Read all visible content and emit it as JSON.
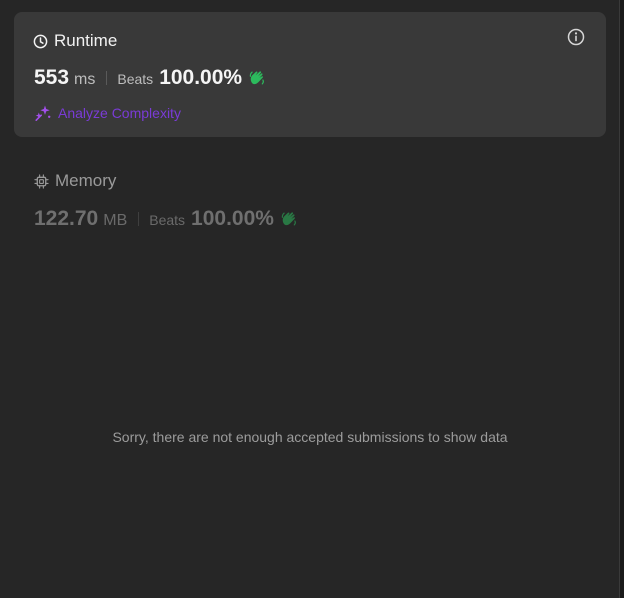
{
  "runtime": {
    "title": "Runtime",
    "value": "553",
    "unit": "ms",
    "beats_label": "Beats",
    "beats_value": "100.00%",
    "analyze_label": "Analyze Complexity"
  },
  "memory": {
    "title": "Memory",
    "value": "122.70",
    "unit": "MB",
    "beats_label": "Beats",
    "beats_value": "100.00%"
  },
  "empty_message": "Sorry, there are not enough accepted submissions to show data",
  "icons": {
    "runtime": "clock-icon",
    "info": "info-icon",
    "beats": "clapping-hands-icon",
    "analyze": "sparkle-icon",
    "memory": "cpu-chip-icon"
  },
  "colors": {
    "background": "#262626",
    "card": "#393939",
    "beats_icon": "#2cbb5d",
    "analyze": "#7a3bd6"
  }
}
